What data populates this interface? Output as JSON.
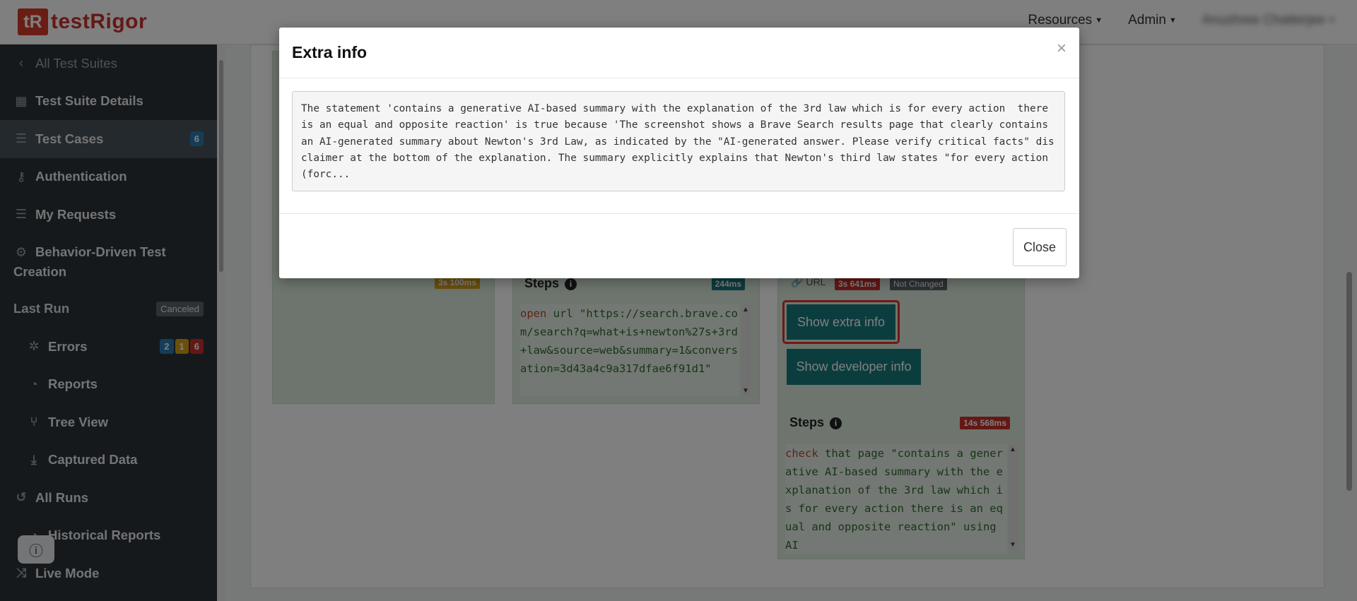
{
  "header": {
    "logo_mark": "tR",
    "logo_text": "testRigor",
    "nav": [
      "Resources",
      "Admin"
    ],
    "user_name": "Anushree Chatterjee"
  },
  "sidebar": {
    "back_label": "All Test Suites",
    "items": [
      {
        "label": "Test Suite Details",
        "icon": "table-icon"
      },
      {
        "label": "Test Cases",
        "icon": "list-icon",
        "badge": "6"
      },
      {
        "label": "Authentication",
        "icon": "key-icon"
      },
      {
        "label": "My Requests",
        "icon": "list-icon"
      },
      {
        "label": "Behavior-Driven Test Creation",
        "icon": "robot-icon"
      }
    ],
    "last_run": {
      "label": "Last Run",
      "status": "Canceled"
    },
    "sub_items": [
      {
        "label": "Errors",
        "icon": "bug-icon",
        "badges": [
          "2",
          "1",
          "6"
        ]
      },
      {
        "label": "Reports",
        "icon": "pie-chart-icon"
      },
      {
        "label": "Tree View",
        "icon": "tree-icon"
      },
      {
        "label": "Captured Data",
        "icon": "download-icon"
      }
    ],
    "all_runs": {
      "label": "All Runs",
      "icon": "history-icon"
    },
    "historical_reports": {
      "label": "Historical Reports",
      "icon": "pie-chart-icon"
    },
    "live_mode": {
      "label": "Live Mode",
      "icon": "shuffle-icon"
    }
  },
  "cards": {
    "card1": {
      "time": "3s 100ms"
    },
    "card2": {
      "steps_label": "Steps",
      "time": "244ms",
      "code_keyword": "open",
      "code_rest": " url \"https://search.brave.com/search?q=what+is+newton%27s+3rd+law&source=web&summary=1&conversation=3d43a4c9a317dfae6f91d1\""
    },
    "card3": {
      "url_label": "URL",
      "time": "3s 641ms",
      "status": "Not Changed",
      "extra_info_button": "Show extra info",
      "developer_info_button": "Show developer info",
      "steps_label": "Steps",
      "steps_time": "14s 568ms",
      "code_keyword": "check",
      "code_rest": " that page \"contains a generative AI-based summary with the explanation of the 3rd law which is for every action there is an equal and opposite reaction\" using AI"
    }
  },
  "modal": {
    "title": "Extra info",
    "close_x": "×",
    "body": "The statement 'contains a generative AI-based summary with the explanation of the 3rd law which is for every action  there is an equal and opposite reaction' is true because 'The screenshot shows a Brave Search results page that clearly contains an AI-generated summary about Newton's 3rd Law, as indicated by the \"AI-generated answer. Please verify critical facts\" disclaimer at the bottom of the explanation. The summary explicitly explains that Newton's third law states \"for every action (forc...",
    "close_button": "Close"
  },
  "colors": {
    "brand": "#d43a2a",
    "sidebar_bg": "#2c3338",
    "teal": "#177a7d",
    "highlight": "#e0332b"
  }
}
